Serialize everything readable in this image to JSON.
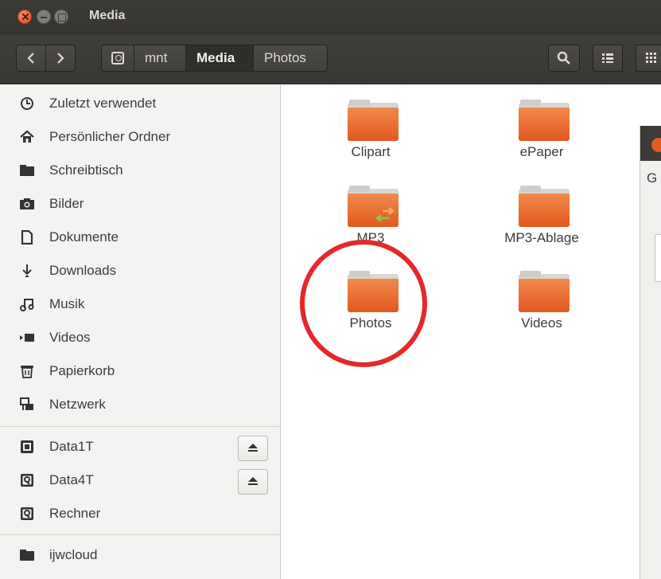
{
  "window": {
    "title": "Media"
  },
  "toolbar": {
    "breadcrumbs": [
      "mnt",
      "Media",
      "Photos"
    ],
    "active_crumb": "Media"
  },
  "sidebar": {
    "places": [
      {
        "label": "Zuletzt verwendet",
        "icon": "clock-icon"
      },
      {
        "label": "Persönlicher Ordner",
        "icon": "home-icon"
      },
      {
        "label": "Schreibtisch",
        "icon": "desktop-folder-icon"
      },
      {
        "label": "Bilder",
        "icon": "camera-icon"
      },
      {
        "label": "Dokumente",
        "icon": "document-icon"
      },
      {
        "label": "Downloads",
        "icon": "download-icon"
      },
      {
        "label": "Musik",
        "icon": "music-icon"
      },
      {
        "label": "Videos",
        "icon": "video-icon"
      },
      {
        "label": "Papierkorb",
        "icon": "trash-icon"
      },
      {
        "label": "Netzwerk",
        "icon": "network-icon"
      }
    ],
    "devices": [
      {
        "label": "Data1T",
        "icon": "drive-icon",
        "ejectable": true
      },
      {
        "label": "Data4T",
        "icon": "drive-icon",
        "ejectable": true
      },
      {
        "label": "Rechner",
        "icon": "drive-icon",
        "ejectable": false
      }
    ],
    "bookmarks": [
      {
        "label": "ijwcloud",
        "icon": "folder-icon"
      }
    ]
  },
  "main": {
    "folders": [
      {
        "label": "Clipart",
        "linked": false
      },
      {
        "label": "ePaper",
        "linked": false
      },
      {
        "label": "MP3",
        "linked": true
      },
      {
        "label": "MP3-Ablage",
        "linked": false
      },
      {
        "label": "Photos",
        "linked": false,
        "highlighted": true
      },
      {
        "label": "Videos",
        "linked": false
      }
    ]
  },
  "other_window": {
    "partial_text": "G"
  },
  "colors": {
    "folder_orange": "#e9672b",
    "highlight_red": "#e6272b",
    "toolbar_dark": "#3c3b37"
  }
}
